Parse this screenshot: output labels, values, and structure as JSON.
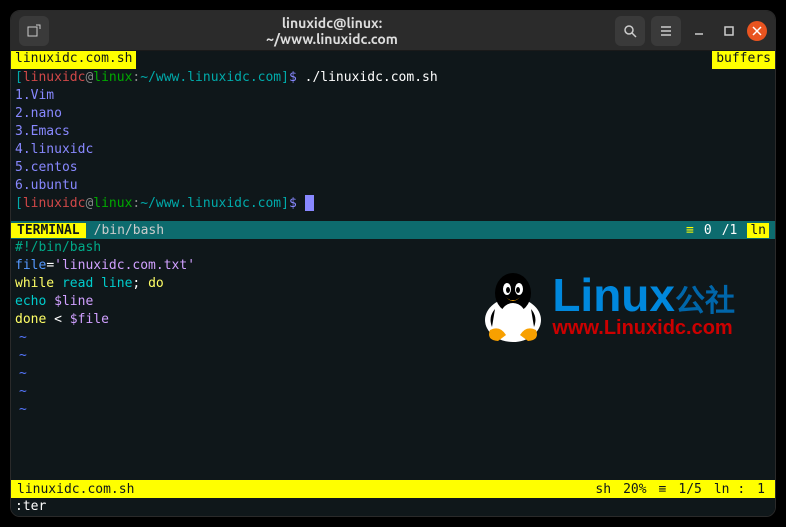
{
  "window": {
    "title": "linuxidc@linux: ~/www.linuxidc.com"
  },
  "buffer": {
    "filename": "linuxidc.com.sh",
    "label": "buffers"
  },
  "prompt": {
    "open": "[",
    "user": "linuxidc",
    "at": "@",
    "host": "linux",
    "colon": ":",
    "cwd": "~/www.linuxidc.com",
    "close": "]",
    "dollar": "$"
  },
  "terminal": {
    "command": "./linuxidc.com.sh",
    "output": [
      "1.Vim",
      "2.nano",
      "3.Emacs",
      "4.linuxidc",
      "5.centos",
      "6.ubuntu"
    ]
  },
  "term_status": {
    "label": "TERMINAL",
    "path": "/bin/bash",
    "pos": "0",
    "total": "/1",
    "ln": "ln"
  },
  "script": {
    "line1": "#!/bin/bash",
    "line2_var": "file",
    "line2_eq": "=",
    "line2_val": "'linuxidc.com.txt'",
    "line3_a": "while",
    "line3_b": " read ",
    "line3_c": "line",
    "line3_d": "; ",
    "line3_e": "do",
    "line4_a": "echo",
    "line4_b": " $line",
    "line5_a": "done",
    "line5_b": " < ",
    "line5_c": "$file"
  },
  "file_status": {
    "filename": "linuxidc.com.sh",
    "filetype": "sh",
    "percent": "20%",
    "pos": "1/5",
    "ln_label": "ln :",
    "col": "1"
  },
  "cmdline": {
    "text": ":ter"
  },
  "watermark": {
    "brand": "Linux",
    "brand_cn": "公社",
    "url": "www.Linuxidc.com"
  }
}
